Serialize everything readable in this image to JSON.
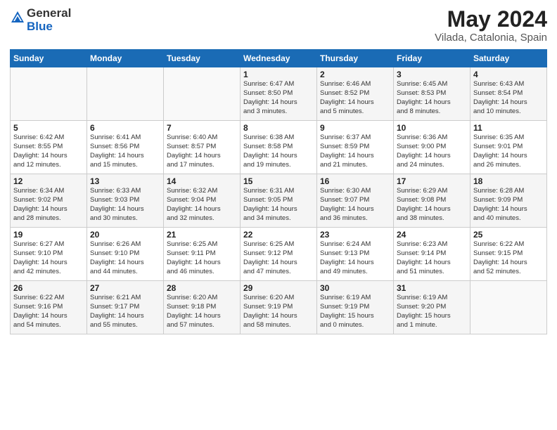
{
  "logo": {
    "general": "General",
    "blue": "Blue"
  },
  "title": "May 2024",
  "location": "Vilada, Catalonia, Spain",
  "weekdays": [
    "Sunday",
    "Monday",
    "Tuesday",
    "Wednesday",
    "Thursday",
    "Friday",
    "Saturday"
  ],
  "weeks": [
    [
      {
        "day": "",
        "info": ""
      },
      {
        "day": "",
        "info": ""
      },
      {
        "day": "",
        "info": ""
      },
      {
        "day": "1",
        "info": "Sunrise: 6:47 AM\nSunset: 8:50 PM\nDaylight: 14 hours\nand 3 minutes."
      },
      {
        "day": "2",
        "info": "Sunrise: 6:46 AM\nSunset: 8:52 PM\nDaylight: 14 hours\nand 5 minutes."
      },
      {
        "day": "3",
        "info": "Sunrise: 6:45 AM\nSunset: 8:53 PM\nDaylight: 14 hours\nand 8 minutes."
      },
      {
        "day": "4",
        "info": "Sunrise: 6:43 AM\nSunset: 8:54 PM\nDaylight: 14 hours\nand 10 minutes."
      }
    ],
    [
      {
        "day": "5",
        "info": "Sunrise: 6:42 AM\nSunset: 8:55 PM\nDaylight: 14 hours\nand 12 minutes."
      },
      {
        "day": "6",
        "info": "Sunrise: 6:41 AM\nSunset: 8:56 PM\nDaylight: 14 hours\nand 15 minutes."
      },
      {
        "day": "7",
        "info": "Sunrise: 6:40 AM\nSunset: 8:57 PM\nDaylight: 14 hours\nand 17 minutes."
      },
      {
        "day": "8",
        "info": "Sunrise: 6:38 AM\nSunset: 8:58 PM\nDaylight: 14 hours\nand 19 minutes."
      },
      {
        "day": "9",
        "info": "Sunrise: 6:37 AM\nSunset: 8:59 PM\nDaylight: 14 hours\nand 21 minutes."
      },
      {
        "day": "10",
        "info": "Sunrise: 6:36 AM\nSunset: 9:00 PM\nDaylight: 14 hours\nand 24 minutes."
      },
      {
        "day": "11",
        "info": "Sunrise: 6:35 AM\nSunset: 9:01 PM\nDaylight: 14 hours\nand 26 minutes."
      }
    ],
    [
      {
        "day": "12",
        "info": "Sunrise: 6:34 AM\nSunset: 9:02 PM\nDaylight: 14 hours\nand 28 minutes."
      },
      {
        "day": "13",
        "info": "Sunrise: 6:33 AM\nSunset: 9:03 PM\nDaylight: 14 hours\nand 30 minutes."
      },
      {
        "day": "14",
        "info": "Sunrise: 6:32 AM\nSunset: 9:04 PM\nDaylight: 14 hours\nand 32 minutes."
      },
      {
        "day": "15",
        "info": "Sunrise: 6:31 AM\nSunset: 9:05 PM\nDaylight: 14 hours\nand 34 minutes."
      },
      {
        "day": "16",
        "info": "Sunrise: 6:30 AM\nSunset: 9:07 PM\nDaylight: 14 hours\nand 36 minutes."
      },
      {
        "day": "17",
        "info": "Sunrise: 6:29 AM\nSunset: 9:08 PM\nDaylight: 14 hours\nand 38 minutes."
      },
      {
        "day": "18",
        "info": "Sunrise: 6:28 AM\nSunset: 9:09 PM\nDaylight: 14 hours\nand 40 minutes."
      }
    ],
    [
      {
        "day": "19",
        "info": "Sunrise: 6:27 AM\nSunset: 9:10 PM\nDaylight: 14 hours\nand 42 minutes."
      },
      {
        "day": "20",
        "info": "Sunrise: 6:26 AM\nSunset: 9:10 PM\nDaylight: 14 hours\nand 44 minutes."
      },
      {
        "day": "21",
        "info": "Sunrise: 6:25 AM\nSunset: 9:11 PM\nDaylight: 14 hours\nand 46 minutes."
      },
      {
        "day": "22",
        "info": "Sunrise: 6:25 AM\nSunset: 9:12 PM\nDaylight: 14 hours\nand 47 minutes."
      },
      {
        "day": "23",
        "info": "Sunrise: 6:24 AM\nSunset: 9:13 PM\nDaylight: 14 hours\nand 49 minutes."
      },
      {
        "day": "24",
        "info": "Sunrise: 6:23 AM\nSunset: 9:14 PM\nDaylight: 14 hours\nand 51 minutes."
      },
      {
        "day": "25",
        "info": "Sunrise: 6:22 AM\nSunset: 9:15 PM\nDaylight: 14 hours\nand 52 minutes."
      }
    ],
    [
      {
        "day": "26",
        "info": "Sunrise: 6:22 AM\nSunset: 9:16 PM\nDaylight: 14 hours\nand 54 minutes."
      },
      {
        "day": "27",
        "info": "Sunrise: 6:21 AM\nSunset: 9:17 PM\nDaylight: 14 hours\nand 55 minutes."
      },
      {
        "day": "28",
        "info": "Sunrise: 6:20 AM\nSunset: 9:18 PM\nDaylight: 14 hours\nand 57 minutes."
      },
      {
        "day": "29",
        "info": "Sunrise: 6:20 AM\nSunset: 9:19 PM\nDaylight: 14 hours\nand 58 minutes."
      },
      {
        "day": "30",
        "info": "Sunrise: 6:19 AM\nSunset: 9:19 PM\nDaylight: 15 hours\nand 0 minutes."
      },
      {
        "day": "31",
        "info": "Sunrise: 6:19 AM\nSunset: 9:20 PM\nDaylight: 15 hours\nand 1 minute."
      },
      {
        "day": "",
        "info": ""
      }
    ]
  ]
}
